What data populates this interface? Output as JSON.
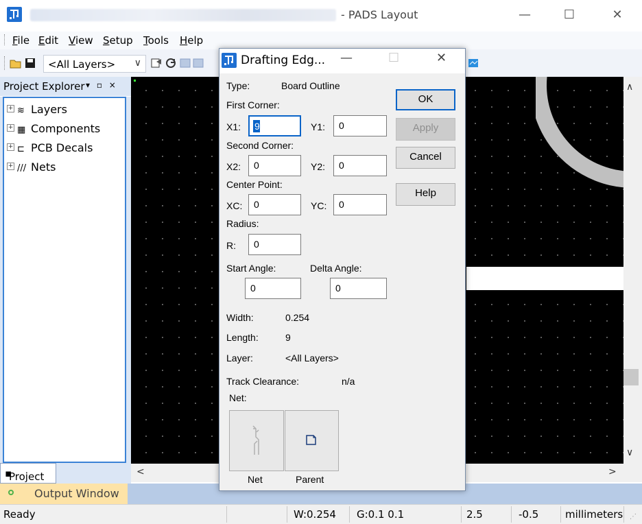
{
  "window": {
    "app_title": "- PADS Layout",
    "minimize": "—",
    "maximize": "☐",
    "close": "✕",
    "icon": "pads-logo-icon"
  },
  "menu": [
    "File",
    "Edit",
    "View",
    "Setup",
    "Tools",
    "Help"
  ],
  "toolbar": {
    "layer_select": "<All Layers>",
    "icons": [
      "open-folder-icon",
      "save-icon",
      "properties-icon",
      "refresh-icon",
      "disabled-icon-1",
      "disabled-icon-2",
      "connect-icon"
    ]
  },
  "project_explorer": {
    "title": "Project Explorer",
    "pin": "▾ ▫ ×",
    "items": [
      {
        "label": "Layers",
        "icon": "layers-icon",
        "glyph": "≋"
      },
      {
        "label": "Components",
        "icon": "components-icon",
        "glyph": "▦"
      },
      {
        "label": "PCB Decals",
        "icon": "pcb-decals-icon",
        "glyph": "⊏"
      },
      {
        "label": "Nets",
        "icon": "nets-icon",
        "glyph": "///"
      }
    ],
    "tab": "Project"
  },
  "output_window": {
    "label": "Output Window"
  },
  "status_bar": {
    "ready": "Ready",
    "width": "W:0.254",
    "grid": "G:0.1 0.1",
    "x": "2.5",
    "y": "-0.5",
    "units": "millimeters"
  },
  "dialog": {
    "title": "Drafting Edg...",
    "type_label": "Type:",
    "type_value": "Board Outline",
    "first_corner": "First Corner:",
    "x1_label": "X1:",
    "x1_value": "9",
    "y1_label": "Y1:",
    "y1_value": "0",
    "second_corner": "Second Corner:",
    "x2_label": "X2:",
    "x2_value": "0",
    "y2_label": "Y2:",
    "y2_value": "0",
    "center_point": "Center Point:",
    "xc_label": "XC:",
    "xc_value": "0",
    "yc_label": "YC:",
    "yc_value": "0",
    "radius": "Radius:",
    "r_label": "R:",
    "r_value": "0",
    "start_angle": "Start Angle:",
    "start_angle_value": "0",
    "delta_angle": "Delta Angle:",
    "delta_angle_value": "0",
    "width_label": "Width:",
    "width_value": "0.254",
    "length_label": "Length:",
    "length_value": "9",
    "layer_label": "Layer:",
    "layer_value": "<All Layers>",
    "track_clearance_label": "Track Clearance:",
    "track_clearance_value": "n/a",
    "net_label": "Net:",
    "buttons": {
      "ok": "OK",
      "apply": "Apply",
      "cancel": "Cancel",
      "help": "Help"
    },
    "net_button": "Net",
    "parent_button": "Parent"
  }
}
